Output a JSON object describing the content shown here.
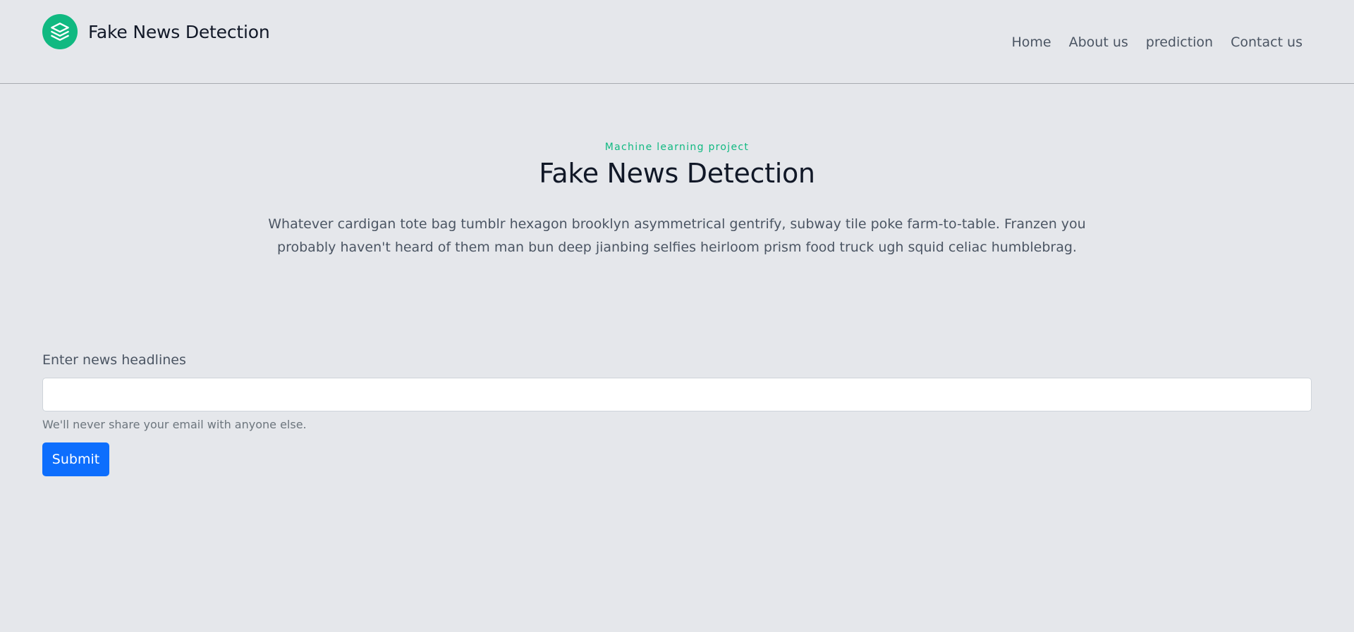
{
  "header": {
    "brand_title": "Fake News Detection",
    "logo_icon": "layers-icon",
    "nav": [
      {
        "label": "Home"
      },
      {
        "label": "About us"
      },
      {
        "label": "prediction"
      },
      {
        "label": "Contact us"
      }
    ]
  },
  "hero": {
    "eyebrow": "Machine learning project",
    "title": "Fake News Detection",
    "text": "Whatever cardigan tote bag tumblr hexagon brooklyn asymmetrical gentrify, subway tile poke farm-to-table. Franzen you probably haven't heard of them man bun deep jianbing selfies heirloom prism food truck ugh squid celiac humblebrag."
  },
  "form": {
    "label": "Enter news headlines",
    "input_value": "",
    "help_text": "We'll never share your email with anyone else.",
    "submit_label": "Submit"
  },
  "colors": {
    "accent": "#10b981",
    "primary_button": "#0d6efd",
    "background": "#e5e7eb"
  }
}
